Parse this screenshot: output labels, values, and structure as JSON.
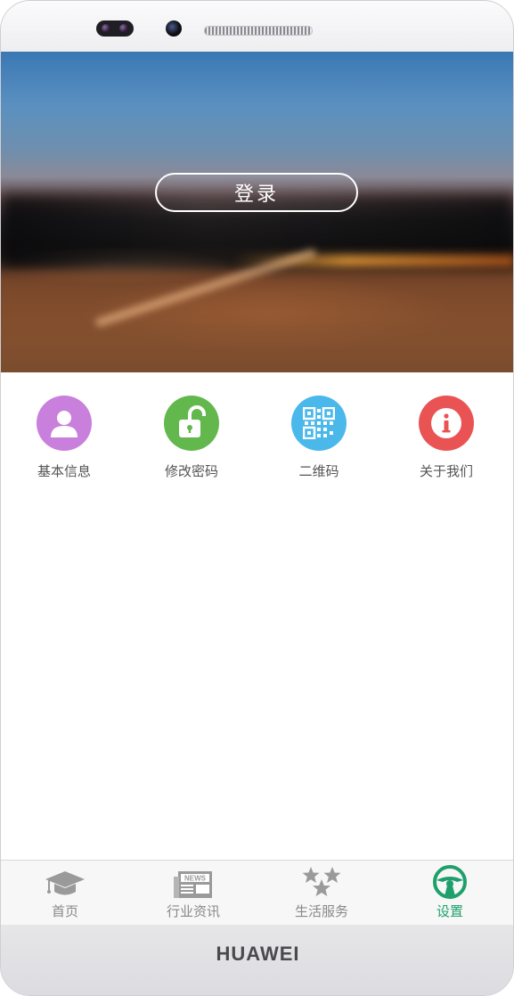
{
  "device": {
    "brand": "HUAWEI"
  },
  "banner": {
    "login_label": "登录"
  },
  "menu": {
    "items": [
      {
        "label": "基本信息",
        "icon": "user-icon",
        "color": "#c97fdc"
      },
      {
        "label": "修改密码",
        "icon": "unlock-icon",
        "color": "#63b84d"
      },
      {
        "label": "二维码",
        "icon": "qrcode-icon",
        "color": "#4ab8ea"
      },
      {
        "label": "关于我们",
        "icon": "info-icon",
        "color": "#ea5353"
      }
    ]
  },
  "tabbar": {
    "active_color": "#1fa06b",
    "items": [
      {
        "label": "首页",
        "icon": "graduation-cap-icon",
        "active": false
      },
      {
        "label": "行业资讯",
        "icon": "newspaper-icon",
        "active": false,
        "icon_text": "NEWS"
      },
      {
        "label": "生活服务",
        "icon": "stars-icon",
        "active": false
      },
      {
        "label": "设置",
        "icon": "steering-wheel-icon",
        "active": true
      }
    ]
  }
}
